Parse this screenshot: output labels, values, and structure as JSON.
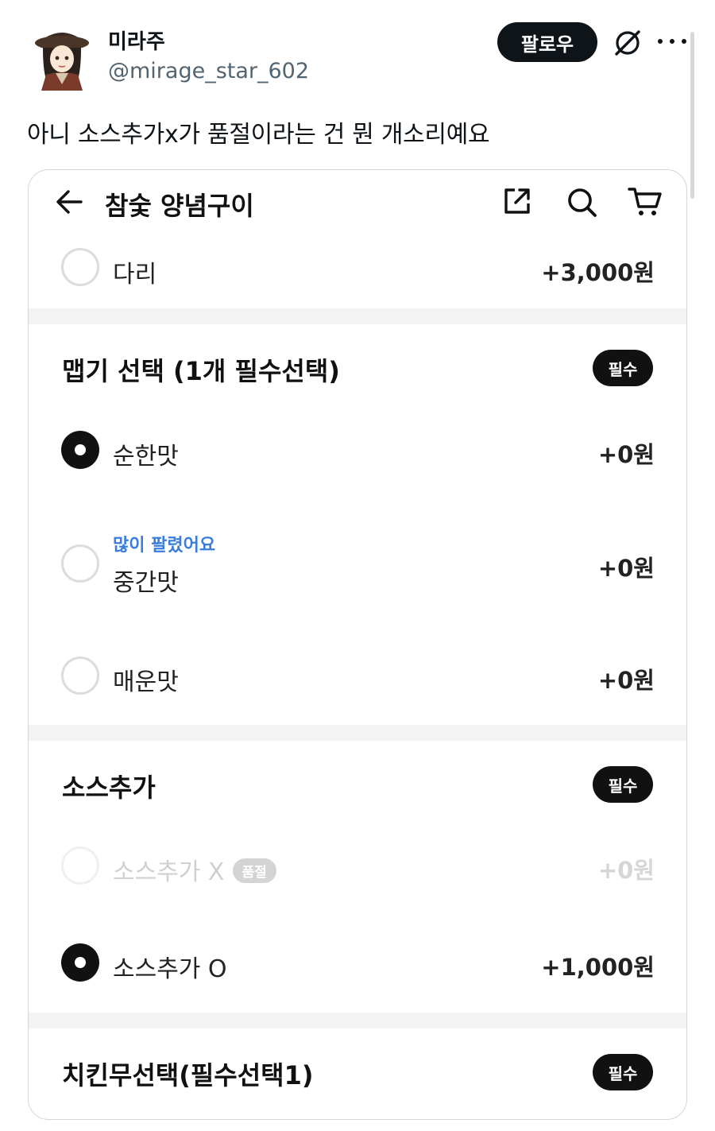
{
  "tweet": {
    "display_name": "미라주",
    "handle": "@mirage_star_602",
    "follow_label": "팔로우",
    "text": "아니 소스추가x가 품절이라는 건 뭔 개소리예요"
  },
  "app": {
    "store_title": "참숯 양념구이",
    "icons": [
      "back-arrow-icon",
      "share-icon",
      "search-icon",
      "cart-icon"
    ]
  },
  "top_option": {
    "label": "다리",
    "price": "+3,000원",
    "selected": false
  },
  "spice_section": {
    "title": "맵기 선택 (1개 필수선택)",
    "badge": "필수",
    "options": [
      {
        "label": "순한맛",
        "price": "+0원",
        "selected": true,
        "tag": ""
      },
      {
        "label": "중간맛",
        "price": "+0원",
        "selected": false,
        "tag": "많이 팔렸어요"
      },
      {
        "label": "매운맛",
        "price": "+0원",
        "selected": false,
        "tag": ""
      }
    ]
  },
  "sauce_section": {
    "title": "소스추가",
    "badge": "필수",
    "options": [
      {
        "label": "소스추가 X",
        "price": "+0원",
        "selected": false,
        "disabled": true,
        "badge": "품절"
      },
      {
        "label": "소스추가 O",
        "price": "+1,000원",
        "selected": true,
        "disabled": false,
        "badge": ""
      }
    ]
  },
  "radish_section": {
    "title": "치킨무선택(필수선택1)",
    "badge": "필수"
  },
  "colors": {
    "text_primary": "#0f1419",
    "text_secondary": "#536471",
    "accent_blue": "#3b7ddd",
    "badge_dark": "#111111",
    "divider": "#f3f3f3"
  }
}
